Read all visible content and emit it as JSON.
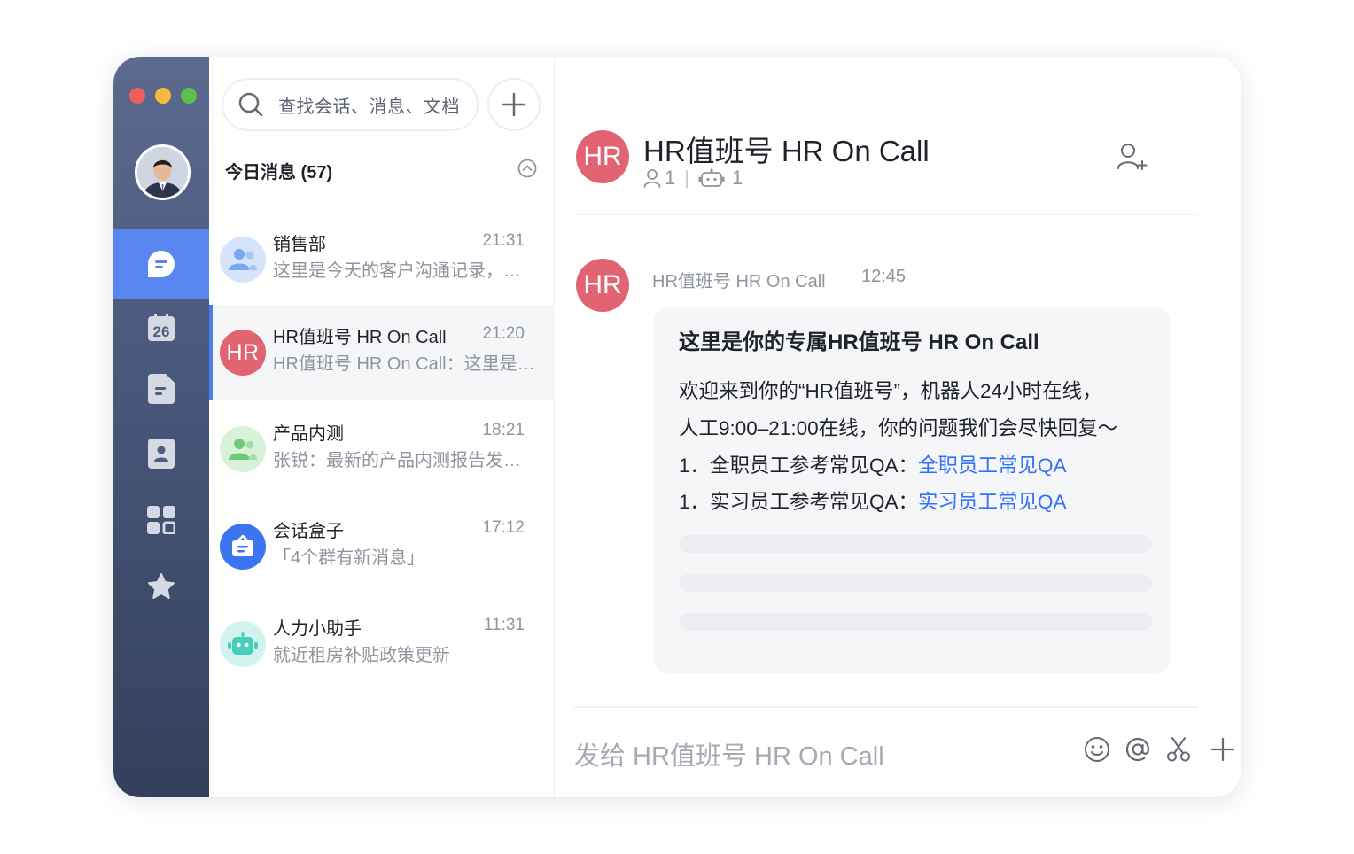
{
  "window": {
    "traffic_lights": [
      "#ee5f59",
      "#f5bb3e",
      "#5bc14b"
    ]
  },
  "rail": {
    "avatar_label": "user-avatar",
    "items": [
      {
        "icon": "chat-icon",
        "active": true
      },
      {
        "icon": "calendar-icon",
        "text": "26"
      },
      {
        "icon": "document-icon"
      },
      {
        "icon": "contacts-icon"
      },
      {
        "icon": "apps-grid-icon"
      },
      {
        "icon": "star-icon"
      }
    ]
  },
  "list": {
    "search_placeholder": "查找会话、消息、文档",
    "section_title": "今日消息 (57)",
    "conversations": [
      {
        "name": "销售部",
        "time": "21:31",
        "preview": "这里是今天的客户沟通记录，…",
        "avatar": "group-icon",
        "avatar_color": "#d6e4fb"
      },
      {
        "name": "HR值班号 HR On Call",
        "time": "21:20",
        "preview": "HR值班号 HR On Call：这里是…",
        "avatar_text": "HR",
        "avatar_color": "#e26472",
        "active": true
      },
      {
        "name": "产品内测",
        "time": "18:21",
        "preview": "张锐：最新的产品内测报告发…",
        "avatar": "group-icon",
        "avatar_color": "#d8f2da"
      },
      {
        "name": "会话盒子",
        "time": "17:12",
        "preview": "「4个群有新消息」",
        "avatar": "chat-box-icon",
        "avatar_color": "#3d75f0"
      },
      {
        "name": "人力小助手",
        "time": "11:31",
        "preview": "就近租房补贴政策更新",
        "avatar": "robot-icon",
        "avatar_color": "#d3f3ef"
      }
    ]
  },
  "chat": {
    "avatar_text": "HR",
    "title": "HR值班号 HR On Call",
    "member_count": "1",
    "bot_count": "1",
    "message": {
      "avatar_text": "HR",
      "sender": "HR值班号 HR On Call",
      "time": "12:45",
      "title": "这里是你的专属HR值班号 HR On Call",
      "line1": "欢迎来到你的“HR值班号”，机器人24小时在线，",
      "line2": "人工9:00–21:00在线，你的问题我们会尽快回复～",
      "item1_prefix": "1．全职员工参考常见QA：",
      "item1_link": "全职员工常见QA",
      "item2_prefix": "1．实习员工参考常见QA：",
      "item2_link": "实习员工常见QA"
    },
    "composer_placeholder": "发给 HR值班号 HR On Call",
    "tools": [
      "emoji-icon",
      "mention-icon",
      "scissors-icon",
      "plus-icon",
      "expand-icon"
    ]
  },
  "colors": {
    "accent": "#5a86f2",
    "link": "#3370ff",
    "hr_red": "#e26472"
  }
}
